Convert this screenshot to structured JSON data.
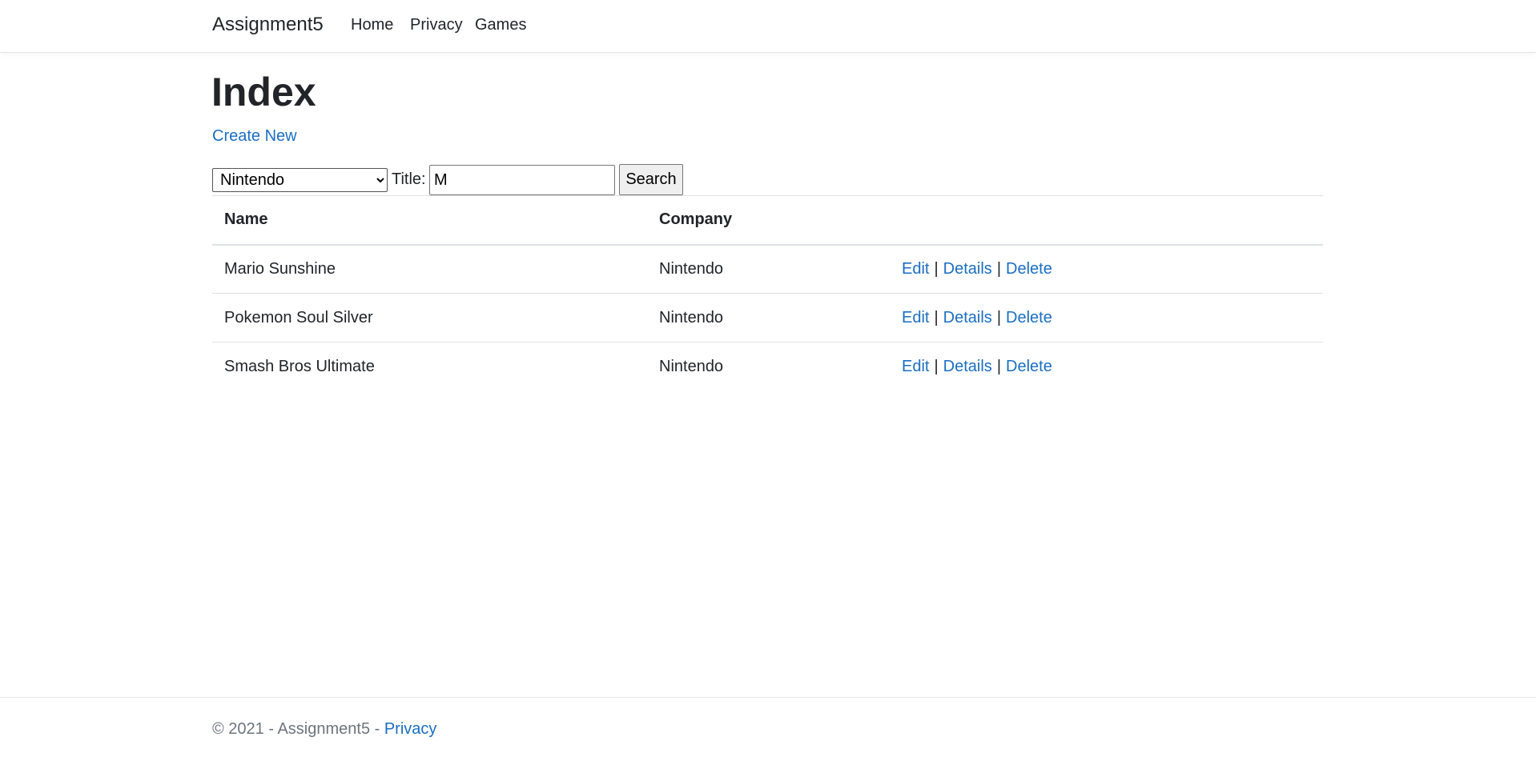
{
  "navbar": {
    "brand": "Assignment5",
    "links": [
      "Home",
      "Privacy",
      "Games"
    ]
  },
  "main": {
    "title": "Index",
    "create_link": "Create New",
    "filter": {
      "company_selected": "Nintendo",
      "title_label": "Title:",
      "title_value": "M",
      "search_label": "Search"
    },
    "table": {
      "headers": [
        "Name",
        "Company",
        ""
      ],
      "rows": [
        {
          "name": "Mario Sunshine",
          "company": "Nintendo"
        },
        {
          "name": "Pokemon Soul Silver",
          "company": "Nintendo"
        },
        {
          "name": "Smash Bros Ultimate",
          "company": "Nintendo"
        }
      ],
      "actions": {
        "edit": "Edit",
        "details": "Details",
        "delete": "Delete",
        "separator": "|"
      }
    }
  },
  "footer": {
    "text": "© 2021 - Assignment5 - ",
    "link": "Privacy"
  },
  "colors": {
    "link": "#1b6ec2",
    "text": "#212529",
    "muted": "#6c757d",
    "border": "#dee2e6"
  }
}
